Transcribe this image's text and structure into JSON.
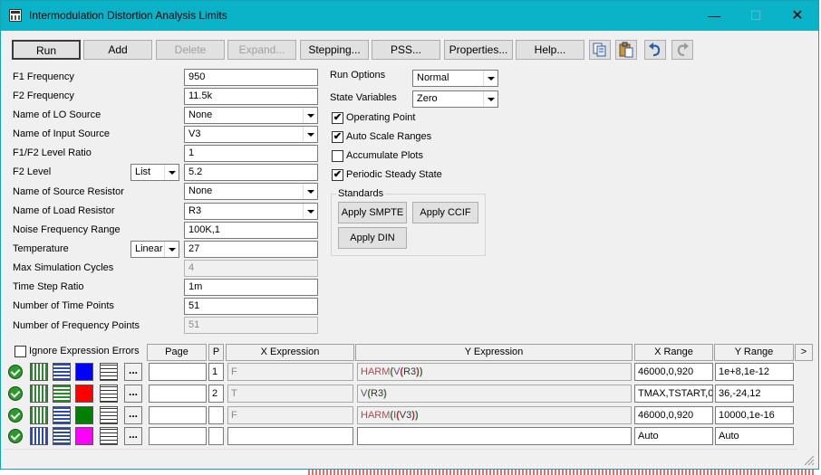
{
  "window": {
    "title": "Intermodulation Distortion Analysis Limits",
    "minimize": "—",
    "maximize": "☐",
    "close": "✕"
  },
  "toolbar": {
    "run": "Run",
    "add": "Add",
    "delete": "Delete",
    "expand": "Expand...",
    "stepping": "Stepping...",
    "pss": "PSS...",
    "properties": "Properties...",
    "help": "Help...",
    "icons": [
      "copy-icon",
      "paste-icon",
      "undo-icon",
      "redo-icon"
    ]
  },
  "form": {
    "f1_frequency": {
      "label": "F1 Frequency",
      "value": "950"
    },
    "f2_frequency": {
      "label": "F2 Frequency",
      "value": "11.5k"
    },
    "lo_source": {
      "label": "Name of LO Source",
      "value": "None"
    },
    "input_source": {
      "label": "Name of Input Source",
      "value": "V3"
    },
    "level_ratio": {
      "label": "F1/F2 Level Ratio",
      "value": "1"
    },
    "f2_level": {
      "label": "F2 Level",
      "mode": "List",
      "value": "5.2"
    },
    "source_resistor": {
      "label": "Name of Source Resistor",
      "value": "None"
    },
    "load_resistor": {
      "label": "Name of Load Resistor",
      "value": "R3"
    },
    "noise_range": {
      "label": "Noise Frequency Range",
      "value": "100K,1"
    },
    "temperature": {
      "label": "Temperature",
      "mode": "Linear",
      "value": "27"
    },
    "max_cycles": {
      "label": "Max Simulation Cycles",
      "value": "4"
    },
    "time_step": {
      "label": "Time Step Ratio",
      "value": "1m"
    },
    "time_points": {
      "label": "Number of Time Points",
      "value": "51"
    },
    "freq_points": {
      "label": "Number of Frequency Points",
      "value": "51"
    }
  },
  "options": {
    "run_options": {
      "label": "Run Options",
      "value": "Normal"
    },
    "state_variables": {
      "label": "State Variables",
      "value": "Zero"
    },
    "operating_point": {
      "label": "Operating Point",
      "checked": true
    },
    "auto_scale": {
      "label": "Auto Scale Ranges",
      "checked": true
    },
    "accumulate": {
      "label": "Accumulate Plots",
      "checked": false
    },
    "periodic": {
      "label": "Periodic Steady State",
      "checked": true
    },
    "check_mark": "✔"
  },
  "standards": {
    "label": "Standards",
    "smpte": "Apply SMPTE",
    "ccif": "Apply CCIF",
    "din": "Apply DIN"
  },
  "table": {
    "ignore_errors": {
      "label": "Ignore Expression Errors",
      "checked": false
    },
    "headers": {
      "page": "Page",
      "p": "P",
      "x": "X Expression",
      "y": "Y Expression",
      "xr": "X Range",
      "yr": "Y Range",
      "more": ">"
    },
    "more_label": "...",
    "rows": [
      {
        "color": "#0000ff",
        "page": "",
        "p": "1",
        "x": "F",
        "y_fn": "HARM",
        "y_arg": "V",
        "y_inner": "R3",
        "xr": "46000,0,920",
        "yr": "1e+8,1e-12"
      },
      {
        "color": "#ff0000",
        "page": "",
        "p": "2",
        "x": "T",
        "y_fn": "",
        "y_arg": "V",
        "y_inner": "R3",
        "xr": "TMAX,TSTART,0.",
        "yr": "36,-24,12"
      },
      {
        "color": "#008000",
        "page": "",
        "p": "",
        "x": "F",
        "y_fn": "HARM",
        "y_arg": "I",
        "y_inner": "V3",
        "xr": "46000,0,920",
        "yr": "10000,1e-16"
      },
      {
        "color": "#ff00ff",
        "page": "",
        "p": "",
        "x": "",
        "y_fn": "",
        "y_arg": "",
        "y_inner": "",
        "xr": "Auto",
        "yr": "Auto"
      }
    ]
  }
}
